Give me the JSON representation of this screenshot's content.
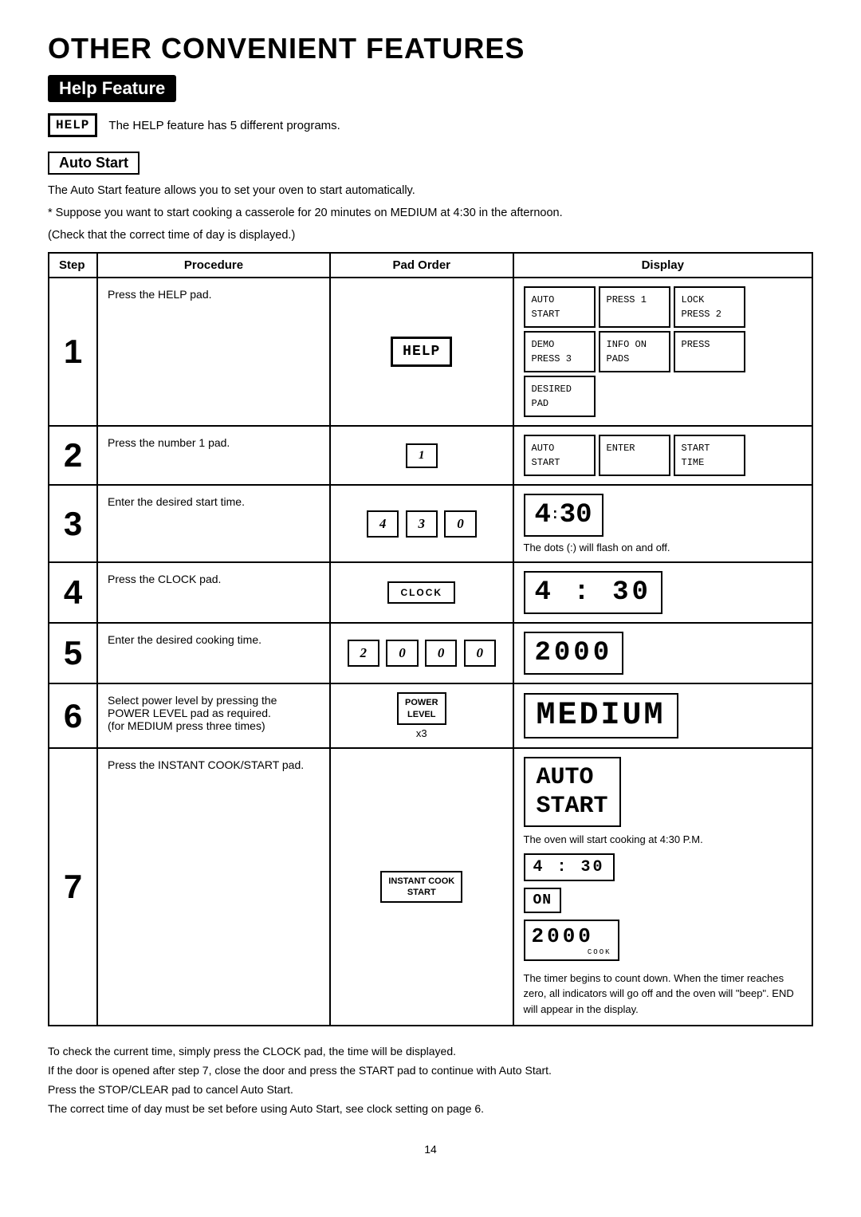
{
  "page": {
    "title": "OTHER CONVENIENT FEATURES",
    "section_label": "Help Feature",
    "help_badge": "HELP",
    "help_intro": "The HELP feature has 5 different programs.",
    "auto_start_label": "Auto Start",
    "auto_start_desc1": "The Auto Start feature allows you to set your oven to start automatically.",
    "auto_start_desc2": "* Suppose you want to start cooking a casserole for 20 minutes on MEDIUM at 4:30 in the afternoon.",
    "auto_start_desc3": "(Check that the correct time of day is displayed.)",
    "table": {
      "headers": [
        "Step",
        "Procedure",
        "Pad Order",
        "Display"
      ],
      "rows": [
        {
          "step": "1",
          "procedure": "Press the HELP pad.",
          "pad_label": "HELP",
          "pad_type": "help"
        },
        {
          "step": "2",
          "procedure": "Press the number 1 pad.",
          "pad_label": "1",
          "pad_type": "number"
        },
        {
          "step": "3",
          "procedure": "Enter the desired start time.",
          "pad_labels": [
            "4",
            "3",
            "0"
          ],
          "pad_type": "numbers"
        },
        {
          "step": "4",
          "procedure": "Press the CLOCK pad.",
          "pad_label": "CLOCK",
          "pad_type": "clock"
        },
        {
          "step": "5",
          "procedure": "Enter the desired cooking time.",
          "pad_labels": [
            "2",
            "0",
            "0",
            "0"
          ],
          "pad_type": "numbers"
        },
        {
          "step": "6",
          "procedure": "Select power level by pressing the POWER LEVEL pad as required.\n(for MEDIUM press three times)",
          "pad_label1": "POWER",
          "pad_label2": "LEVEL",
          "pad_type": "power",
          "x3": "x3"
        },
        {
          "step": "7",
          "procedure": "Press the INSTANT COOK/START pad.",
          "pad_label1": "INSTANT COOK",
          "pad_label2": "START",
          "pad_type": "instant"
        }
      ]
    },
    "footer": {
      "line1": "To check the current time, simply press the CLOCK pad, the time will be displayed.",
      "line2": "If the door is opened after step 7, close the door and press the START pad to continue with Auto Start.",
      "line3": "Press the STOP/CLEAR pad to cancel Auto Start.",
      "line4": "The correct time of day must be set before using Auto Start, see clock setting on page 6."
    },
    "page_number": "14"
  }
}
